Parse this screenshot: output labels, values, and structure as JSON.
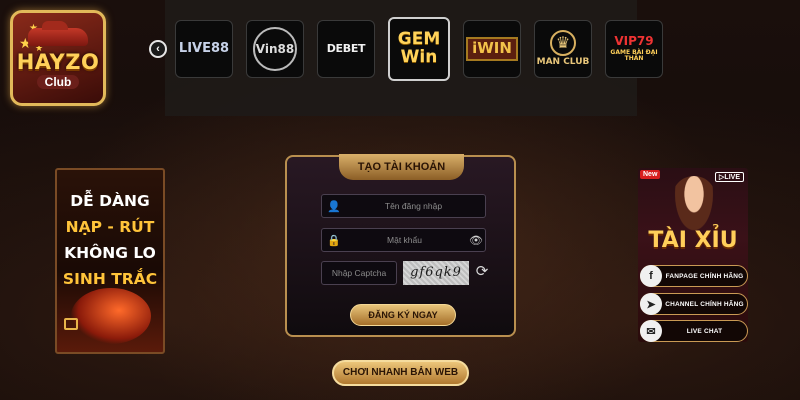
{
  "logo": {
    "brand": "HAYZO",
    "sub": "Club"
  },
  "nav": {
    "prev_icon": "chevron-left-icon",
    "next_icon": "chevron-right-icon"
  },
  "games": [
    {
      "label": "LIVE88"
    },
    {
      "label": "Vin88"
    },
    {
      "label": "DEBET"
    },
    {
      "label": "GEM Win"
    },
    {
      "label": "iWIN"
    },
    {
      "label": "MAN CLUB"
    },
    {
      "label": "VIP79",
      "sub": "GAME BÀI ĐẠI THẦN"
    }
  ],
  "banner_left": {
    "line1": "DỄ DÀNG",
    "line2": "NẠP - RÚT",
    "line3": "KHÔNG LO",
    "line4": "SINH TRẮC"
  },
  "banner_right": {
    "new_badge": "New",
    "live_badge": "▷LIVE",
    "title": "TÀI XỈU",
    "fanpage": "FANPAGE CHÍNH HÃNG",
    "channel": "CHANNEL CHÍNH HÃNG",
    "live_chat": "LIVE CHAT"
  },
  "form": {
    "title": "TẠO TÀI KHOẢN",
    "username_placeholder": "Tên đăng nhập",
    "password_placeholder": "Mật khẩu",
    "captcha_placeholder": "Nhập Captcha",
    "captcha_text": "gf6qk9",
    "register_button": "ĐĂNG KÝ NGAY"
  },
  "play_web_button": "CHƠI NHANH BẢN WEB"
}
